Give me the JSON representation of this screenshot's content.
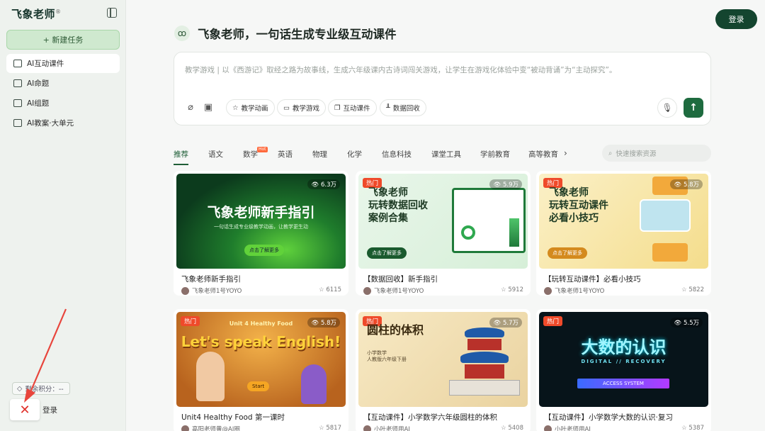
{
  "sidebar": {
    "logo": "飞象老师",
    "new_task": "+ 新建任务",
    "items": [
      {
        "label": "AI互动课件"
      },
      {
        "label": "AI命题"
      },
      {
        "label": "AI组题"
      },
      {
        "label": "AI教案·大单元"
      }
    ],
    "points_label": "剩余积分：--",
    "login": "登录"
  },
  "header": {
    "title": "飞象老师，一句话生成专业级互动课件",
    "login_button": "登录"
  },
  "prompt": {
    "placeholder": "教学游戏 | 以《西游记》取经之路为故事线，生成六年级课内古诗词闯关游戏，让学生在游戏化体验中变“被动背诵”为“主动探究”。",
    "chips": [
      "教学动画",
      "教学游戏",
      "互动课件",
      "数据回收"
    ]
  },
  "tabs": [
    "推荐",
    "语文",
    "数学",
    "英语",
    "物理",
    "化学",
    "信息科技",
    "课堂工具",
    "学前教育",
    "高等教育"
  ],
  "hot_badge": "Hot",
  "search_placeholder": "快速搜索资源",
  "cards": [
    {
      "title": "飞象老师新手指引",
      "author": "飞象老师1号YOYO",
      "views": "6.3万",
      "stars": "6115",
      "hot": "",
      "thumb_title": "飞象老师新手指引",
      "thumb_sub": "一句话生成专业级教学动画，让教学更生动",
      "cta": "点击了解更多"
    },
    {
      "title": "【数据回收】新手指引",
      "author": "飞象老师1号YOYO",
      "views": "5.9万",
      "stars": "5912",
      "hot": "热门",
      "thumb_lines": [
        "飞象老师",
        "玩转数据回收",
        "案例合集"
      ],
      "cta": "点击了解更多"
    },
    {
      "title": "【玩转互动课件】必看小技巧",
      "author": "飞象老师1号YOYO",
      "views": "5.8万",
      "stars": "5822",
      "hot": "热门",
      "thumb_lines": [
        "飞象老师",
        "玩转互动课件",
        "必看小技巧"
      ],
      "cta": "点击了解更多"
    },
    {
      "title": "Unit4 Healthy Food 第一课时",
      "author": "高阳老师黄@AI圈",
      "views": "5.8万",
      "stars": "5817",
      "hot": "热门",
      "thumb_top": "Unit 4 Healthy Food",
      "thumb_big": "Let's speak English!",
      "cta": "Start"
    },
    {
      "title": "【互动课件】小学数学六年级圆柱的体积",
      "author": "小叶老师用AI",
      "views": "5.7万",
      "stars": "5408",
      "hot": "热门",
      "thumb_big": "圆柱的体积",
      "thumb_sub": "小学数学\n人教版六年级下册"
    },
    {
      "title": "【互动课件】小学数学大数的认识·复习",
      "author": "小叶老师用AI",
      "views": "5.5万",
      "stars": "5387",
      "hot": "热门",
      "thumb_big": "大数的认识",
      "thumb_sub": "DIGITAL // RECOVERY",
      "cta": "ACCESS SYSTEM"
    }
  ]
}
